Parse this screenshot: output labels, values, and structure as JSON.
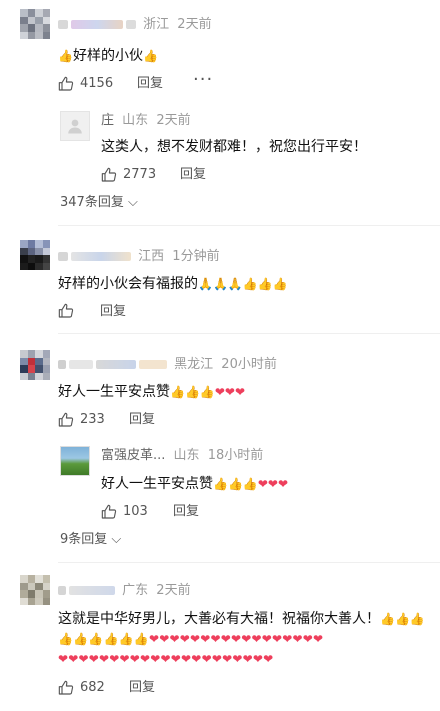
{
  "colors": {
    "accent": "#e94b4b",
    "meta": "#9a9a9a"
  },
  "icons": {
    "like": "thumb-up-outline-icon",
    "chevron": "chevron-down-icon"
  },
  "comments": [
    {
      "location": "浙江",
      "time": "2天前",
      "text": "好样的小伙",
      "likes": "4156",
      "reply_label": "回复",
      "replies": [
        {
          "name": "庄",
          "location": "山东",
          "time": "2天前",
          "text": "这类人，想不发财都难！，祝您出行平安！",
          "likes": "2773",
          "reply_label": "回复"
        }
      ],
      "more_replies": "347条回复"
    },
    {
      "location": "江西",
      "time": "1分钟前",
      "text": "好样的小伙会有福报的",
      "likes": "",
      "reply_label": "回复"
    },
    {
      "location": "黑龙江",
      "time": "20小时前",
      "text": "好人一生平安点赞",
      "likes": "233",
      "reply_label": "回复",
      "replies": [
        {
          "name": "富强皮革...",
          "location": "山东",
          "time": "18小时前",
          "text": "好人一生平安点赞",
          "likes": "103",
          "reply_label": "回复"
        }
      ],
      "more_replies": "9条回复"
    },
    {
      "location": "广东",
      "time": "2天前",
      "text": "这就是中华好男儿，大善必有大福！祝福你大善人！",
      "likes": "682",
      "reply_label": "回复"
    }
  ]
}
